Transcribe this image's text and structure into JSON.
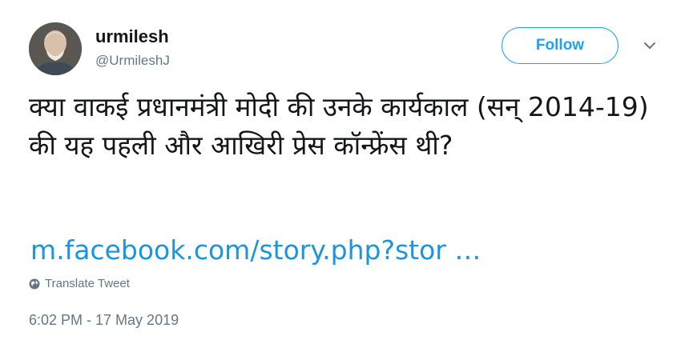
{
  "user": {
    "display_name": "urmilesh",
    "handle": "@UrmileshJ"
  },
  "follow_button": {
    "label": "Follow"
  },
  "menu": {
    "icon": "chevron-down-icon"
  },
  "tweet": {
    "text": "क्या वाकई प्रधानमंत्री मोदी की उनके कार्यकाल (सन् 2014-19) की यह पहली और आखिरी प्रेस कॉन्फ्रेंस थी?",
    "link_text": "m.facebook.com/story.php?stor …",
    "translate_label": "Translate Tweet",
    "timestamp": "6:02 PM - 17 May 2019"
  },
  "colors": {
    "accent": "#1da1f2",
    "link": "#1b95e0",
    "secondary_text": "#657786",
    "primary_text": "#14171a"
  }
}
